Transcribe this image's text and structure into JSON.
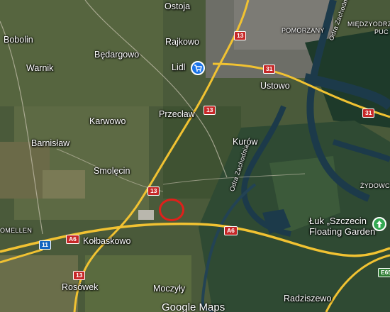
{
  "places": {
    "ostoja": "Ostoja",
    "bobolin": "Bobolin",
    "rajkowo": "Rajkowo",
    "pomorzany": "POMORZANY",
    "miedzyodrze": "MIĘDZYODRZE",
    "pucisko": "PUC",
    "bedargowo": "Będargowo",
    "lidl": "Lidl",
    "warnik": "Warnik",
    "ustowo": "Ustowo",
    "przeclaw": "Przecław",
    "karwowo": "Karwowo",
    "kurow": "Kurów",
    "barnislaw": "Barnisław",
    "smolecin": "Smolęcin",
    "zydowce": "ŻYDOWC",
    "odra_zachodnia_north": "Odra Zachodnia",
    "odra_zachodnia_south": "Odra Zachodnia",
    "luk_line1": "Łuk „Szczecin",
    "luk_line2": "Floating Garden",
    "omellen": "OMELLEN",
    "kolbaskowo": "Kołbaskowo",
    "rosowek": "Rosówek",
    "moczyly": "Moczyły",
    "radziszewo": "Radziszewo"
  },
  "road_shields": {
    "r13_top": "13",
    "r13_mid": "13",
    "r13_low": "13",
    "r13_bottom": "13",
    "r31_top": "31",
    "r31_right": "31",
    "a6_left": "A6",
    "a6_mid": "A6",
    "e11": "11",
    "e65": "E65"
  },
  "icons": {
    "shopping_pin": "shopping-cart-icon",
    "attraction_pin": "attraction-icon"
  },
  "colors": {
    "highway": "#f1c232",
    "river": "#1c3a4a",
    "marker": "#e0201a",
    "shield_red": "#c62828"
  },
  "watermark": "Google Maps"
}
